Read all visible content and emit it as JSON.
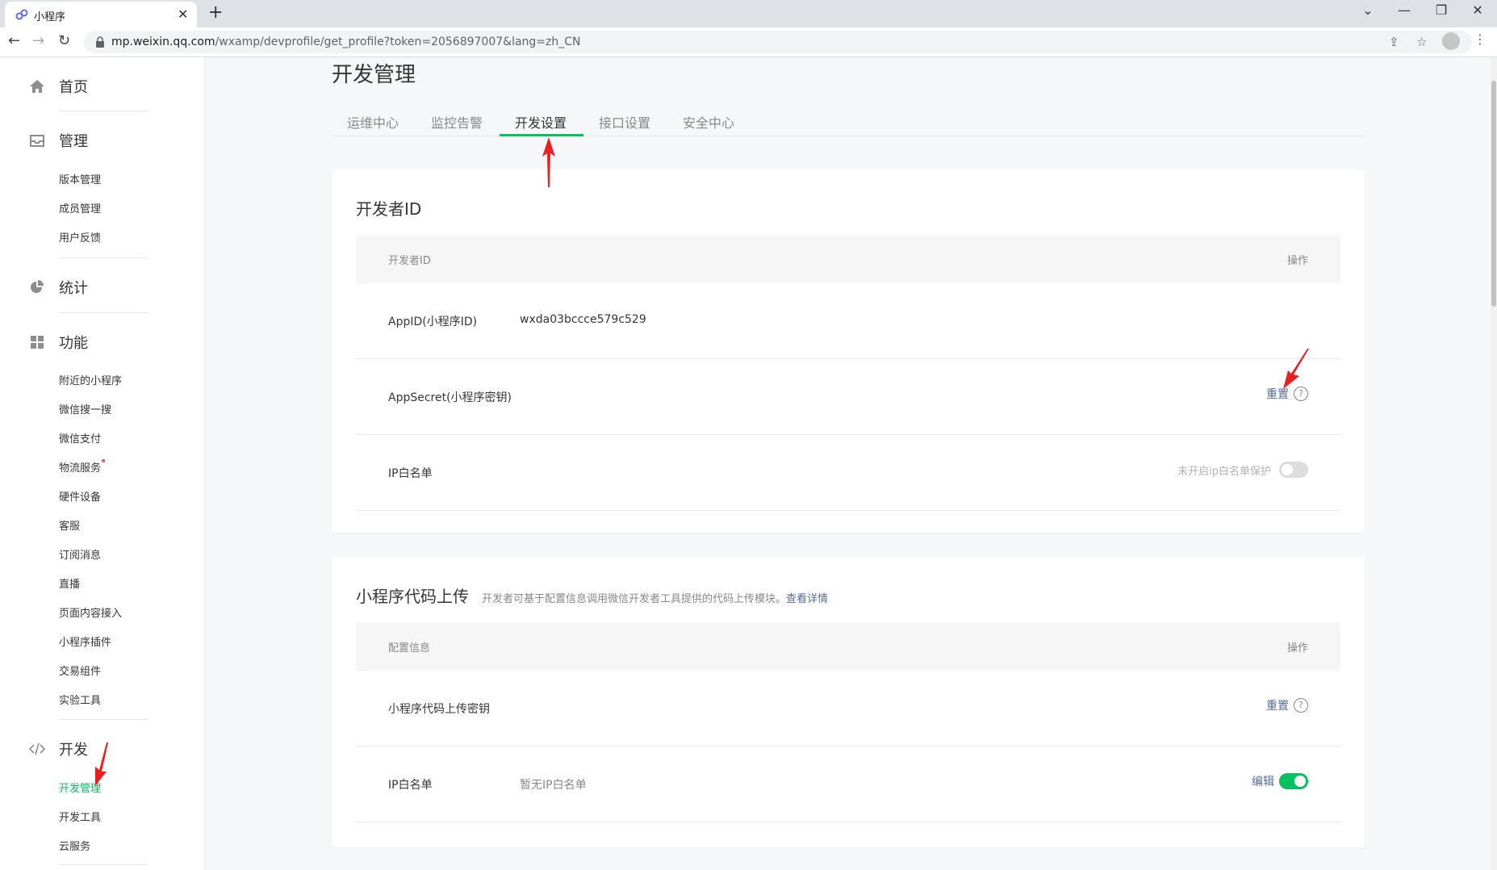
{
  "browser": {
    "tab_title": "小程序",
    "url_host": "mp.weixin.qq.com",
    "url_path": "/wxamp/devprofile/get_profile?token=2056897007&lang=zh_CN"
  },
  "sidebar": {
    "home": "首页",
    "manage": {
      "label": "管理",
      "items": [
        "版本管理",
        "成员管理",
        "用户反馈"
      ]
    },
    "stats": "统计",
    "features": {
      "label": "功能",
      "items": [
        "附近的小程序",
        "微信搜一搜",
        "微信支付",
        "物流服务",
        "硬件设备",
        "客服",
        "订阅消息",
        "直播",
        "页面内容接入",
        "小程序插件",
        "交易组件",
        "实验工具"
      ]
    },
    "dev": {
      "label": "开发",
      "items": [
        "开发管理",
        "开发工具",
        "云服务"
      ]
    }
  },
  "main": {
    "title": "开发管理",
    "tabs": [
      "运维中心",
      "监控告警",
      "开发设置",
      "接口设置",
      "安全中心"
    ],
    "active_tab": "开发设置"
  },
  "developer_id_card": {
    "title": "开发者ID",
    "header_left": "开发者ID",
    "header_right": "操作",
    "appid_label": "AppID(小程序ID)",
    "appid_value": "wxda03bccce579c529",
    "secret_label": "AppSecret(小程序密钥)",
    "secret_action": "重置",
    "ip_label": "IP白名单",
    "ip_status": "未开启ip白名单保护",
    "ip_toggle": false
  },
  "upload_card": {
    "title": "小程序代码上传",
    "desc": "开发者可基于配置信息调用微信开发者工具提供的代码上传模块。",
    "desc_link": "查看详情",
    "header_left": "配置信息",
    "header_right": "操作",
    "key_label": "小程序代码上传密钥",
    "key_action": "重置",
    "ip_label": "IP白名单",
    "ip_value": "暂无IP白名单",
    "ip_action": "编辑",
    "ip_toggle": true
  },
  "colors": {
    "accent": "#07c160",
    "link": "#576b95",
    "annotation": "#e8201f"
  }
}
